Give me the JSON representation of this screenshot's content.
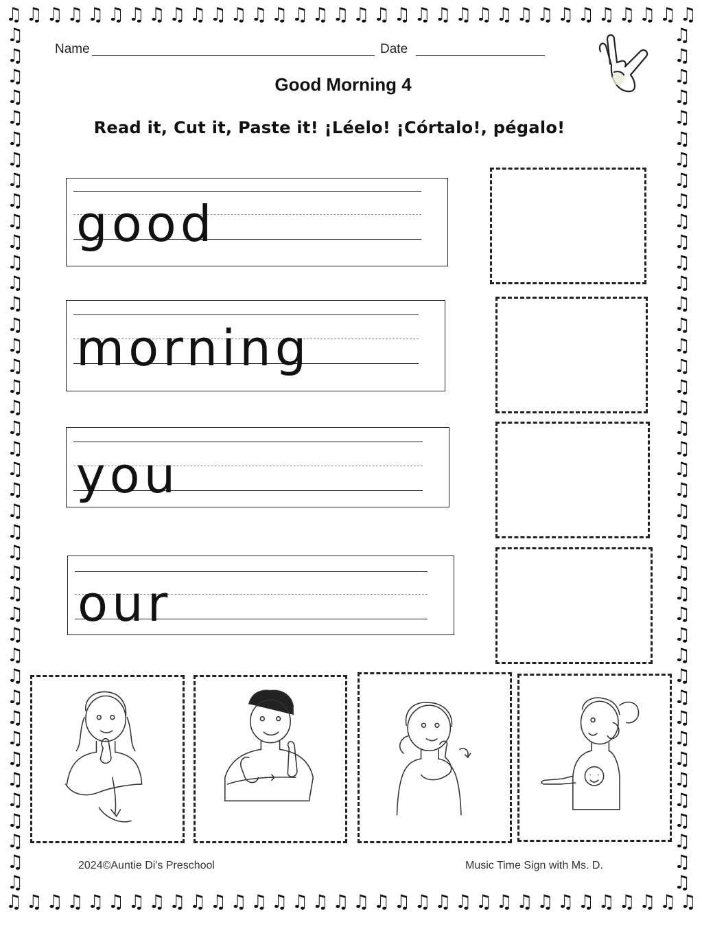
{
  "header": {
    "name_label": "Name",
    "date_label": "Date",
    "title": "Good Morning  4",
    "instructions": "Read it, Cut it, Paste it! ¡Léelo! ¡Córtalo!, pégalo!"
  },
  "words": [
    {
      "text": "good"
    },
    {
      "text": "morning"
    },
    {
      "text": "you"
    },
    {
      "text": "our"
    }
  ],
  "icons": {
    "logo": "asl-i-love-you-hand-icon",
    "border": "music-note-icon",
    "signs": [
      "sign-good-icon",
      "sign-morning-icon",
      "sign-you-icon",
      "sign-our-icon"
    ]
  },
  "footer": {
    "copyright": "2024©Auntie Di's Preschool",
    "credit": "Music Time Sign with Ms. D."
  }
}
